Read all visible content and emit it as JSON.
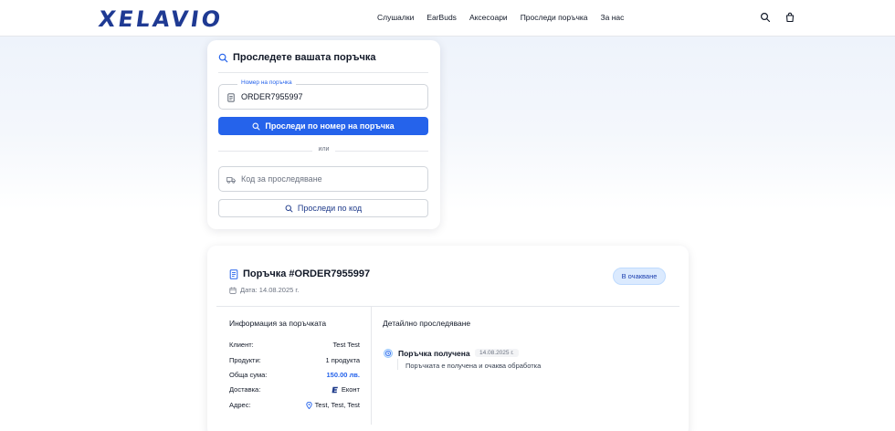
{
  "brand": {
    "logo": "XELAVIO",
    "color": "#1f3a93"
  },
  "nav": {
    "items": [
      "Слушалки",
      "EarBuds",
      "Аксесоари",
      "Проследи поръчка",
      "За нас"
    ]
  },
  "header": {
    "icons": [
      "search-icon",
      "cart-icon"
    ]
  },
  "track": {
    "title": "Проследете вашата поръчка",
    "order_field": {
      "legend": "Номер на поръчка",
      "value": "ORDER7955997"
    },
    "order_button": "Проследи по номер на поръчка",
    "or": "или",
    "code_field": {
      "placeholder": "Код за проследяване",
      "value": ""
    },
    "code_button": "Проследи по код"
  },
  "order": {
    "title": "Поръчка #ORDER7955997",
    "date": "Дата: 14.08.2025 г.",
    "status": "В очакване",
    "info_heading": "Информация за поръчката",
    "info": [
      {
        "label": "Клиент:",
        "value": "Test Test"
      },
      {
        "label": "Продукти:",
        "value": "1 продукта"
      },
      {
        "label": "Обща сума:",
        "value": "150.00 лв."
      },
      {
        "label": "Доставка:",
        "value": "Еконт"
      },
      {
        "label": "Адрес:",
        "value": "Test, Test, Test"
      }
    ],
    "tracking_heading": "Детайлно проследяване",
    "events": [
      {
        "title": "Поръчка получена",
        "date": "14.08.2025 г.",
        "description": "Поръчката е получена и очаква обработка"
      }
    ]
  },
  "colors": {
    "accent": "#2563eb",
    "badge_bg": "#dbeafe",
    "badge_text": "#1e40af"
  }
}
